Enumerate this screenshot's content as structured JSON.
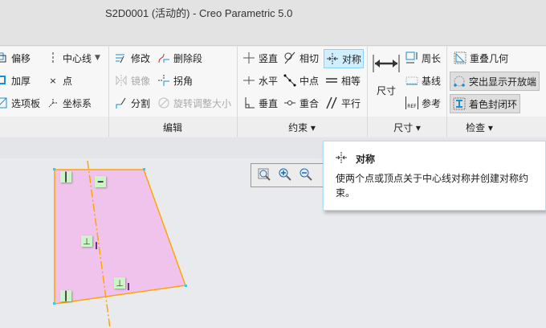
{
  "window": {
    "title": "S2D0001 (活动的) - Creo Parametric 5.0"
  },
  "ribbon": {
    "sketch_group": {
      "items": [
        {
          "label": "偏移",
          "icon": "offset-icon"
        },
        {
          "label": "加厚",
          "icon": "thicken-icon"
        },
        {
          "label": "选项板",
          "icon": "palette-icon"
        },
        {
          "label": "中心线",
          "icon": "centerline-icon"
        },
        {
          "label": "点",
          "icon": "point-icon"
        },
        {
          "label": "坐标系",
          "icon": "coordinate-system-icon"
        }
      ],
      "dropdown": "▼"
    },
    "edit_group": {
      "label": "编辑",
      "items": [
        {
          "label": "修改"
        },
        {
          "label": "删除段"
        },
        {
          "label": "镜像"
        },
        {
          "label": "拐角"
        },
        {
          "label": "分割"
        },
        {
          "label": "旋转调整大小"
        }
      ]
    },
    "constrain_group": {
      "label": "约束 ▾",
      "items": [
        {
          "label": "竖直"
        },
        {
          "label": "相切"
        },
        {
          "label": "对称"
        },
        {
          "label": "水平"
        },
        {
          "label": "中点"
        },
        {
          "label": "相等"
        },
        {
          "label": "垂直"
        },
        {
          "label": "重合"
        },
        {
          "label": "平行"
        }
      ]
    },
    "dimension_group": {
      "label": "尺寸 ▾",
      "big": "尺寸",
      "items": [
        {
          "label": "周长"
        },
        {
          "label": "基线"
        },
        {
          "label": "参考"
        }
      ]
    },
    "inspect_group": {
      "label": "检查 ▾",
      "items": [
        {
          "label": "重叠几何"
        },
        {
          "label": "突出显示开放端"
        },
        {
          "label": "着色封闭环"
        }
      ]
    }
  },
  "tooltip": {
    "title": "对称",
    "body": "使两个点或顶点关于中心线对称并创建对称约束。"
  },
  "colors": {
    "sketch_fill": "#efc3ec",
    "sketch_line": "#ffa500",
    "highlight": "#cfeefe"
  }
}
